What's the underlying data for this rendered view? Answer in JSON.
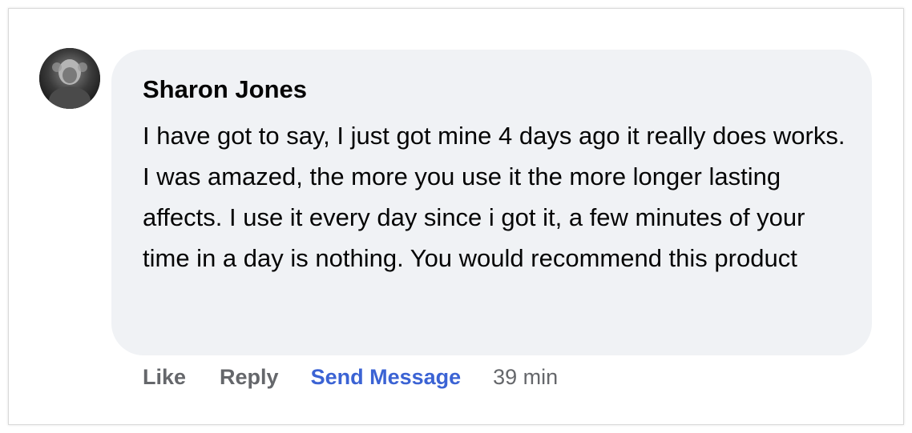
{
  "comment": {
    "author": "Sharon Jones",
    "text": "I have got to say, I just got mine 4 days ago it really does works. I was amazed, the more you use it the more longer lasting affects. I use it every day since i got it, a few minutes of your time in a day is nothing. You would recommend this product",
    "bubble_color": "#f0f2f5"
  },
  "actions": {
    "like_label": "Like",
    "reply_label": "Reply",
    "send_message_label": "Send Message",
    "timestamp": "39 min",
    "send_message_color": "#3b63d4",
    "muted_color": "#65676b"
  }
}
